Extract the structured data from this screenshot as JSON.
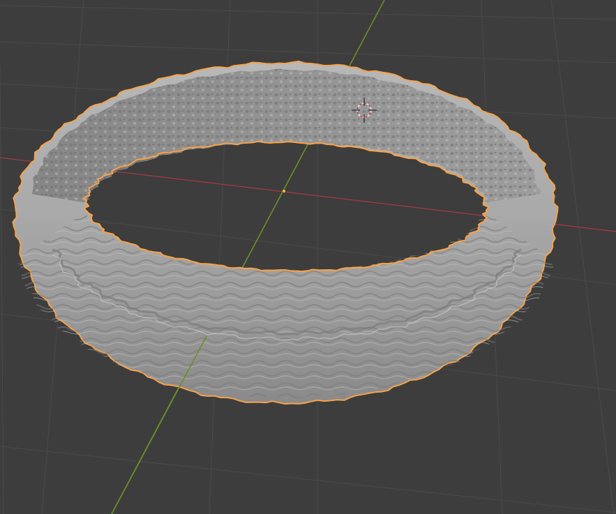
{
  "viewport": {
    "background_color": "#3d3d3d",
    "grid_color": "#4a4a4a",
    "x_axis_color": "#a53a44",
    "y_axis_color": "#6a8f2a",
    "object_name": "ring",
    "object_color": "#a3a3a3",
    "selection_outline_color": "#f5a24a",
    "origin_color": "#f2b640",
    "cursor_color": "#e8e8e8",
    "cursor_accent_color": "#d04040",
    "selected": true
  }
}
